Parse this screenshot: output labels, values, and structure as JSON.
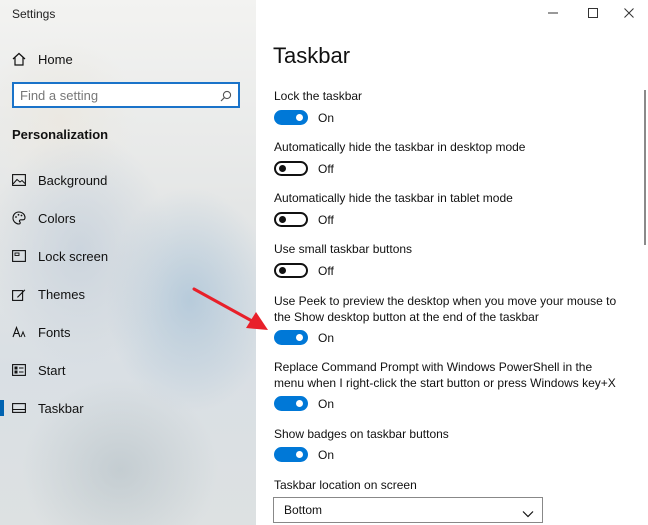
{
  "app": {
    "title": "Settings"
  },
  "sidebar": {
    "home_label": "Home",
    "search": {
      "placeholder": "Find a setting",
      "value": ""
    },
    "section_heading": "Personalization",
    "items": [
      {
        "label": "Background",
        "icon": "image-icon"
      },
      {
        "label": "Colors",
        "icon": "palette-icon"
      },
      {
        "label": "Lock screen",
        "icon": "lock-screen-icon"
      },
      {
        "label": "Themes",
        "icon": "brush-icon"
      },
      {
        "label": "Fonts",
        "icon": "font-icon"
      },
      {
        "label": "Start",
        "icon": "start-icon"
      },
      {
        "label": "Taskbar",
        "icon": "taskbar-icon",
        "active": true
      }
    ]
  },
  "main": {
    "title": "Taskbar",
    "settings": [
      {
        "label": "Lock the taskbar",
        "state": "On"
      },
      {
        "label": "Automatically hide the taskbar in desktop mode",
        "state": "Off"
      },
      {
        "label": "Automatically hide the taskbar in tablet mode",
        "state": "Off"
      },
      {
        "label": "Use small taskbar buttons",
        "state": "Off"
      },
      {
        "label": "Use Peek to preview the desktop when you move your mouse to the Show desktop button at the end of the taskbar",
        "state": "On"
      },
      {
        "label": "Replace Command Prompt with Windows PowerShell in the menu when I right-click the start button or press Windows key+X",
        "state": "On"
      },
      {
        "label": "Show badges on taskbar buttons",
        "state": "On"
      }
    ],
    "location": {
      "label": "Taskbar location on screen",
      "value": "Bottom"
    }
  },
  "colors": {
    "accent": "#0078d7",
    "arrow": "#e8202a"
  }
}
